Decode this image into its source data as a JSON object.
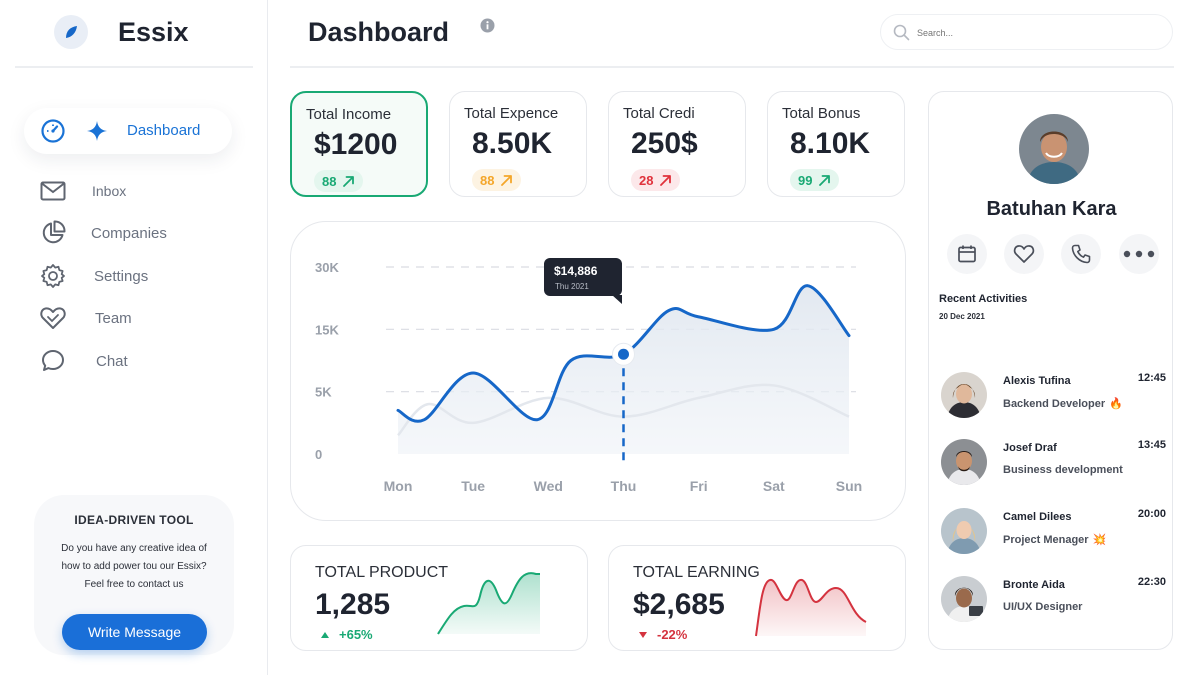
{
  "app": {
    "name": "Essix",
    "logo_icon": "leaf-icon",
    "accent_color": "#1a73d6"
  },
  "sidebar": {
    "items": [
      {
        "label": "Dashboard",
        "icon": "speedometer-icon",
        "active": true
      },
      {
        "label": "Inbox",
        "icon": "mail-icon",
        "active": false
      },
      {
        "label": "Companies",
        "icon": "pie-chart-icon",
        "active": false
      },
      {
        "label": "Settings",
        "icon": "gear-icon",
        "active": false
      },
      {
        "label": "Team",
        "icon": "heart-hands-icon",
        "active": false
      },
      {
        "label": "Chat",
        "icon": "chat-bubble-icon",
        "active": false
      }
    ],
    "promo": {
      "title": "IDEA-DRIVEN TOOL",
      "text": "Do you have any creative idea of how to add power tou our Essix? Feel free to contact us",
      "button_label": "Write Message"
    }
  },
  "header": {
    "title": "Dashboard",
    "search_placeholder": "Search..."
  },
  "stats": [
    {
      "title": "Total Income",
      "value": "$1200",
      "badge": "88",
      "badge_color": "#19a974",
      "active": true
    },
    {
      "title": "Total Expence",
      "value": "8.50K",
      "badge": "88",
      "badge_color": "#f4a62a",
      "active": false
    },
    {
      "title": "Total Credi",
      "value": "250$",
      "badge": "28",
      "badge_color": "#e0323c",
      "active": false
    },
    {
      "title": "Total Bonus",
      "value": "8.10K",
      "badge": "99",
      "badge_color": "#19a974",
      "active": false
    }
  ],
  "chart_data": {
    "type": "line",
    "categories": [
      "Mon",
      "Tue",
      "Wed",
      "Thu",
      "Fri",
      "Sat",
      "Sun"
    ],
    "y_ticks": [
      "30K",
      "15K",
      "5K",
      "0"
    ],
    "series": [
      {
        "values": [
          [
            0,
            7
          ],
          [
            0.35,
            5.5
          ],
          [
            1,
            13
          ],
          [
            1.85,
            5.5
          ],
          [
            2.3,
            15
          ],
          [
            3,
            16
          ],
          [
            3.6,
            23
          ],
          [
            4,
            22
          ],
          [
            5,
            20
          ],
          [
            5.45,
            27
          ],
          [
            6,
            19
          ]
        ]
      },
      {
        "values": [
          [
            0,
            3
          ],
          [
            0.4,
            8
          ],
          [
            1,
            5
          ],
          [
            2,
            9
          ],
          [
            3,
            6
          ],
          [
            4,
            9
          ],
          [
            5,
            11
          ],
          [
            6,
            6
          ]
        ]
      }
    ],
    "highlight": {
      "category": "Thu",
      "value": "$14,886",
      "date": "Thu 2021"
    },
    "grid": true
  },
  "bottom_cards": [
    {
      "title": "TOTAL PRODUCT",
      "value": "1,285",
      "change": "+65%",
      "direction": "up",
      "color": "#19a974"
    },
    {
      "title": "TOTAL EARNING",
      "value": "$2,685",
      "change": "-22%",
      "direction": "down",
      "color": "#d4333f"
    }
  ],
  "profile": {
    "name": "Batuhan Kara",
    "actions": [
      "calendar-icon",
      "heart-icon",
      "phone-icon",
      "more-icon"
    ],
    "recent_title": "Recent Activities",
    "recent_date": "20 Dec 2021",
    "activities": [
      {
        "name": "Alexis Tufina",
        "role": "Backend Developer",
        "emoji": "🔥",
        "time": "12:45"
      },
      {
        "name": "Josef Draf",
        "role": "Business development",
        "emoji": "",
        "time": "13:45"
      },
      {
        "name": "Camel Dilees",
        "role": "Project Menager",
        "emoji": "💥",
        "time": "20:00"
      },
      {
        "name": "Bronte Aida",
        "role": "UI/UX Designer",
        "emoji": "",
        "time": "22:30"
      }
    ]
  }
}
